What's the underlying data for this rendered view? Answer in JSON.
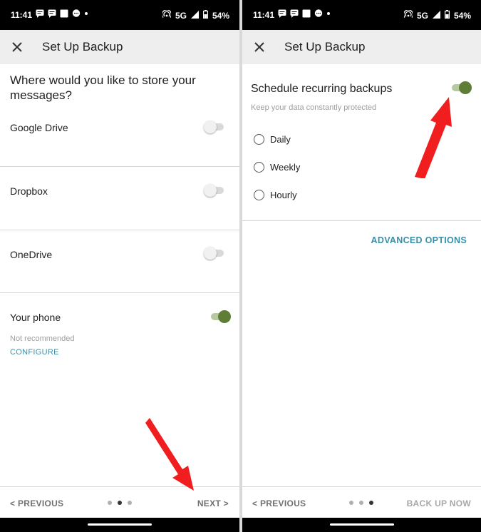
{
  "status_bar": {
    "time": "11:41",
    "network": "5G",
    "battery": "54%"
  },
  "screen1": {
    "title": "Set Up Backup",
    "question": "Where would you like to store your messages?",
    "options": [
      {
        "label": "Google Drive",
        "enabled": false
      },
      {
        "label": "Dropbox",
        "enabled": false
      },
      {
        "label": "OneDrive",
        "enabled": false
      },
      {
        "label": "Your phone",
        "enabled": true,
        "note": "Not recommended",
        "action": "CONFIGURE"
      }
    ],
    "footer": {
      "previous": "< PREVIOUS",
      "next": "NEXT >",
      "page_index": 2,
      "page_count": 3
    }
  },
  "screen2": {
    "title": "Set Up Backup",
    "schedule_label": "Schedule recurring backups",
    "schedule_enabled": true,
    "schedule_subtitle": "Keep your data constantly protected",
    "frequency_options": [
      "Daily",
      "Weekly",
      "Hourly"
    ],
    "advanced_options": "ADVANCED OPTIONS",
    "footer": {
      "previous": "< PREVIOUS",
      "back_up_now": "BACK UP NOW",
      "page_index": 3,
      "page_count": 3
    }
  },
  "colors": {
    "accent_green": "#5f7d35",
    "link_teal": "#3a8fa8",
    "annotation_red": "#f01e1e"
  }
}
